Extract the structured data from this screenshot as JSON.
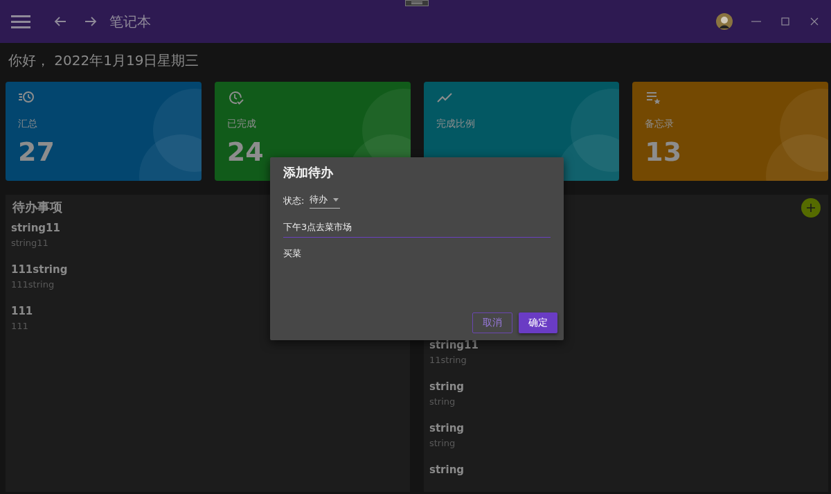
{
  "window": {
    "title": "笔记本"
  },
  "greeting": "你好， 2022年1月19日星期三",
  "stats": [
    {
      "kind": "summary",
      "label": "汇总",
      "value": "27",
      "color": "#03466f"
    },
    {
      "kind": "done",
      "label": "已完成",
      "value": "24",
      "color": "#115b1a"
    },
    {
      "kind": "ratio",
      "label": "完成比例",
      "color": "#035863"
    },
    {
      "kind": "memo",
      "label": "备忘录",
      "value": "13",
      "color": "#744902"
    }
  ],
  "panels": [
    {
      "title": "待办事项",
      "items": [
        {
          "title": "string11",
          "subtitle": "string11"
        },
        {
          "title": "111string",
          "subtitle": "111string"
        },
        {
          "title": "111",
          "subtitle": "111"
        }
      ]
    },
    {
      "add_button": true,
      "items": [
        {
          "title": "string11",
          "subtitle": "11string"
        },
        {
          "title": "string",
          "subtitle": "string"
        },
        {
          "title": "string",
          "subtitle": "string"
        },
        {
          "title": "string"
        }
      ]
    }
  ],
  "dialog": {
    "title": "添加待办",
    "status_label": "状态:",
    "status_value": "待办",
    "title_value": "下午3点去菜市场",
    "title_focused": true,
    "content_value": "买菜",
    "buttons": [
      {
        "label": "取消",
        "kind": "outlined"
      },
      {
        "label": "确定",
        "kind": "filled"
      }
    ]
  }
}
